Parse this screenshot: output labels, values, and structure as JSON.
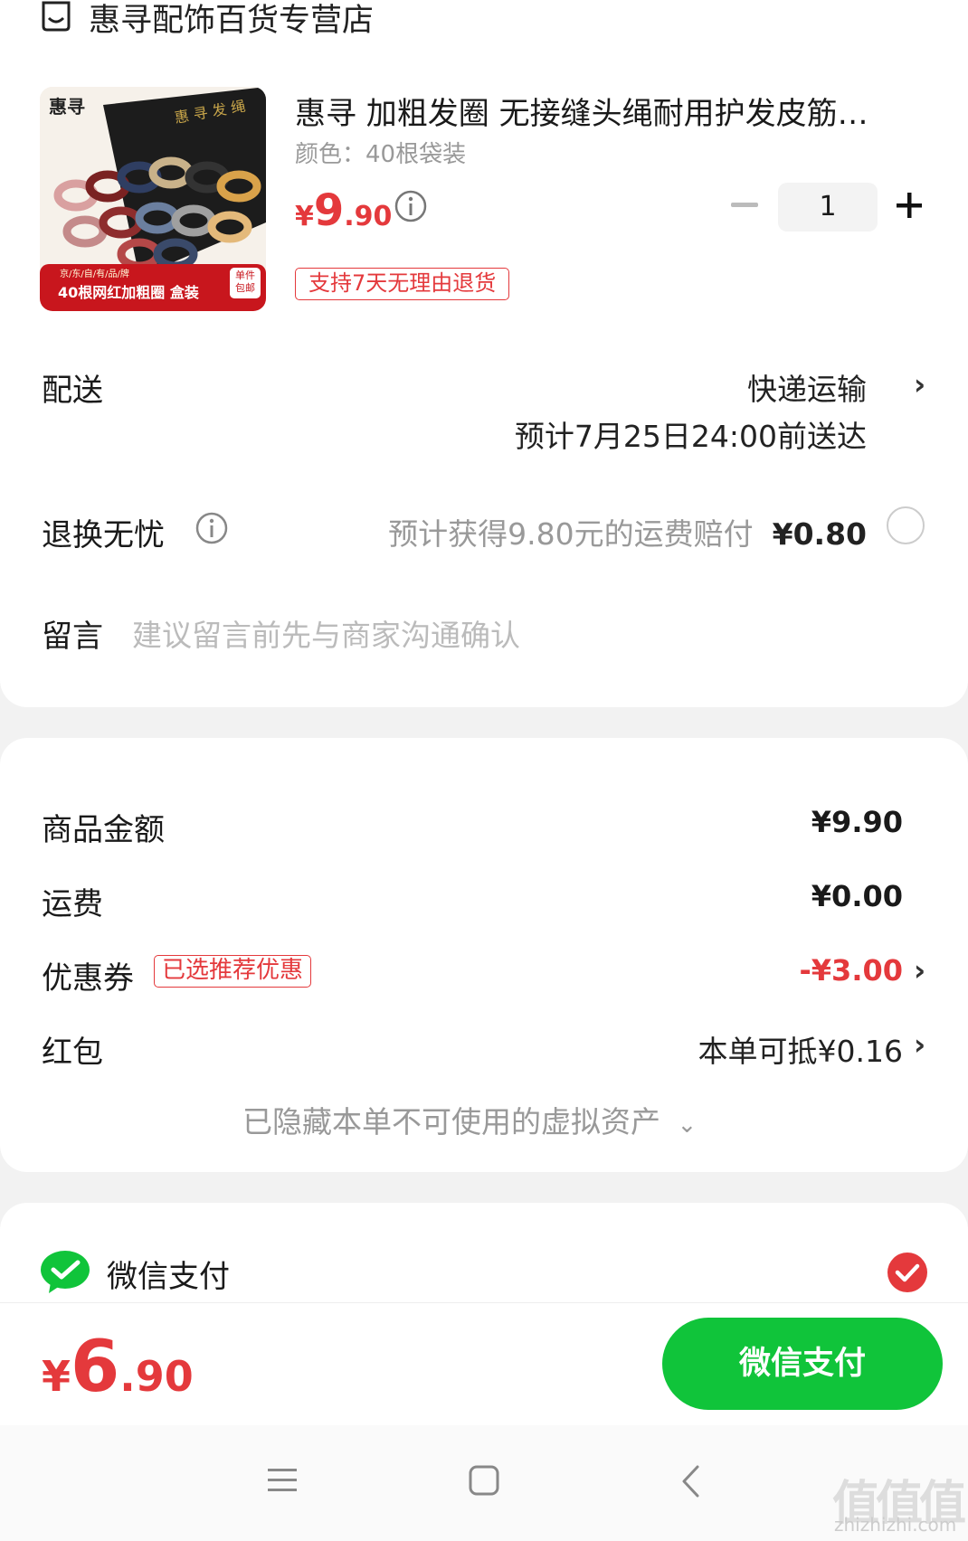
{
  "store": {
    "name": "惠寻配饰百货专营店",
    "icon": "store-icon"
  },
  "product": {
    "title": "惠寻 加粗发圈 无接缝头绳耐用护发皮筋…",
    "variant": "颜色：40根袋装",
    "price_symbol": "¥",
    "price_int": "9",
    "price_dec": ".90",
    "quantity": "1",
    "return_badge": "支持7天无理由退货",
    "image": {
      "brand": "惠寻",
      "subline": "京/东/自/有/品/牌",
      "caption": "40根网红加粗圈 盒装",
      "tag": "单件包邮"
    }
  },
  "delivery": {
    "label": "配送",
    "method": "快递运输",
    "eta": "预计7月25日24:00前送达"
  },
  "exchange": {
    "label": "退换无忧",
    "desc": "预计获得9.80元的运费赔付",
    "price": "¥0.80"
  },
  "message": {
    "label": "留言",
    "placeholder": "建议留言前先与商家沟通确认"
  },
  "summary": {
    "goods_label": "商品金额",
    "goods_value": "¥9.90",
    "shipping_label": "运费",
    "shipping_value": "¥0.00",
    "coupon_label": "优惠券",
    "coupon_tag": "已选推荐优惠",
    "coupon_value": "-¥3.00",
    "redpacket_label": "红包",
    "redpacket_value": "本单可抵¥0.16",
    "hidden_assets": "已隐藏本单不可使用的虚拟资产"
  },
  "payment": {
    "method": "微信支付"
  },
  "footer": {
    "total_symbol": "¥",
    "total_int": "6",
    "total_dec": ".90",
    "pay_button": "微信支付"
  },
  "watermark": {
    "main": "值值值",
    "sub": "zhizhizhi.com"
  },
  "colors": {
    "accent_red": "#e4393c",
    "wechat_green": "#10c43a"
  }
}
